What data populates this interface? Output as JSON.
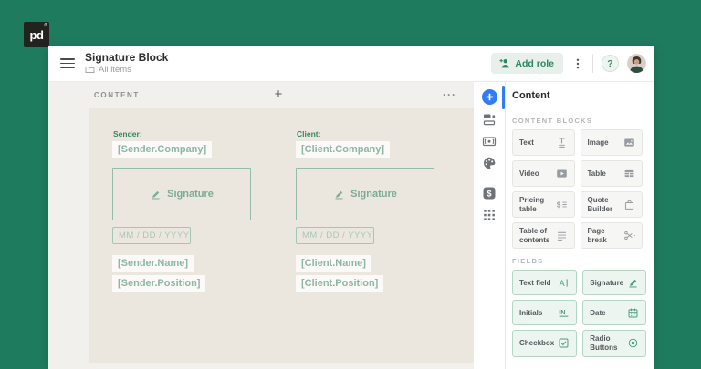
{
  "brand": {
    "logo_text": "pd",
    "registered_mark": "®"
  },
  "header": {
    "title": "Signature Block",
    "breadcrumb": "All items",
    "add_role_label": "Add role",
    "help_label": "?"
  },
  "canvas": {
    "section_label": "CONTENT",
    "add_block_label": "+",
    "menu_label": "···"
  },
  "document": {
    "columns": [
      {
        "party_label": "Sender:",
        "company": "[Sender.Company]",
        "signature_label": "Signature",
        "date_placeholder": "MM / DD / YYYY",
        "name": "[Sender.Name]",
        "position": "[Sender.Position]"
      },
      {
        "party_label": "Client:",
        "company": "[Client.Company]",
        "signature_label": "Signature",
        "date_placeholder": "MM / DD / YYYY",
        "name": "[Client.Name]",
        "position": "[Client.Position]"
      }
    ]
  },
  "rail": {
    "items": [
      {
        "name": "add-content",
        "icon": "plus-circle-icon",
        "active": true
      },
      {
        "name": "saved-blocks",
        "icon": "blocks-icon",
        "active": false
      },
      {
        "name": "variables",
        "icon": "banknote-icon",
        "active": false
      },
      {
        "name": "design",
        "icon": "palette-icon",
        "active": false
      },
      {
        "name": "pricing-catalog",
        "icon": "dollar-icon",
        "active": false
      },
      {
        "name": "apps",
        "icon": "apps-grid-icon",
        "active": false
      }
    ]
  },
  "panel": {
    "title": "Content",
    "sections": [
      {
        "label": "CONTENT BLOCKS",
        "tiles": [
          {
            "label": "Text",
            "icon": "text-icon"
          },
          {
            "label": "Image",
            "icon": "image-icon"
          },
          {
            "label": "Video",
            "icon": "video-icon"
          },
          {
            "label": "Table",
            "icon": "table-icon"
          },
          {
            "label": "Pricing table",
            "icon": "pricing-table-icon"
          },
          {
            "label": "Quote Builder",
            "icon": "quote-builder-icon"
          },
          {
            "label": "Table of contents",
            "icon": "table-of-contents-icon"
          },
          {
            "label": "Page break",
            "icon": "page-break-icon"
          }
        ]
      },
      {
        "label": "FIELDS",
        "tiles": [
          {
            "label": "Text field",
            "icon": "text-field-icon"
          },
          {
            "label": "Signature",
            "icon": "signature-icon"
          },
          {
            "label": "Initials",
            "icon": "initials-icon"
          },
          {
            "label": "Date",
            "icon": "date-icon"
          },
          {
            "label": "Checkbox",
            "icon": "checkbox-icon"
          },
          {
            "label": "Radio Buttons",
            "icon": "radio-buttons-icon"
          }
        ]
      }
    ]
  },
  "colors": {
    "brand_green": "#1e7b5e",
    "accent_blue": "#2f7cf5",
    "field_green": "#4a9b78",
    "document_beige": "#ebe7de"
  }
}
